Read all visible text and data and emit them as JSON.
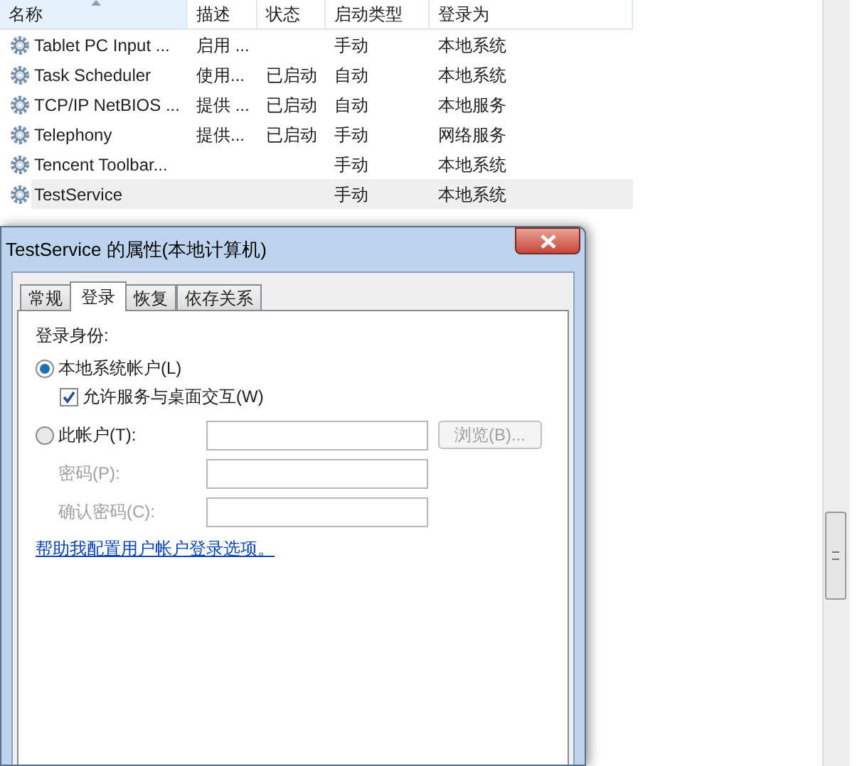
{
  "services": {
    "columns": [
      {
        "label": "名称",
        "sorted": true
      },
      {
        "label": "描述",
        "sorted": false
      },
      {
        "label": "状态",
        "sorted": false
      },
      {
        "label": "启动类型",
        "sorted": false
      },
      {
        "label": "登录为",
        "sorted": false
      }
    ],
    "rows": [
      {
        "name": "Tablet PC Input ...",
        "description": "启用 ...",
        "status": "",
        "startup": "手动",
        "logon": "本地系统",
        "selected": false
      },
      {
        "name": "Task Scheduler",
        "description": "使用...",
        "status": "已启动",
        "startup": "自动",
        "logon": "本地系统",
        "selected": false
      },
      {
        "name": "TCP/IP NetBIOS ...",
        "description": "提供 ...",
        "status": "已启动",
        "startup": "自动",
        "logon": "本地服务",
        "selected": false
      },
      {
        "name": "Telephony",
        "description": "提供...",
        "status": "已启动",
        "startup": "手动",
        "logon": "网络服务",
        "selected": false
      },
      {
        "name": "Tencent Toolbar...",
        "description": "",
        "status": "",
        "startup": "手动",
        "logon": "本地系统",
        "selected": false
      },
      {
        "name": "TestService",
        "description": "",
        "status": "",
        "startup": "手动",
        "logon": "本地系统",
        "selected": true
      }
    ]
  },
  "dialog": {
    "title": "TestService 的属性(本地计算机)",
    "tabs": [
      {
        "label": "常规",
        "selected": false
      },
      {
        "label": "登录",
        "selected": true
      },
      {
        "label": "恢复",
        "selected": false
      },
      {
        "label": "依存关系",
        "selected": false
      }
    ],
    "logon_as": "登录身份:",
    "local_system": {
      "label": "本地系统帐户(L)",
      "selected": true
    },
    "interact": {
      "label": "允许服务与桌面交互(W)",
      "checked": true
    },
    "this_account": {
      "label": "此帐户(T):",
      "selected": false
    },
    "browse_button": {
      "label": "浏览(B)...",
      "disabled": true
    },
    "password": {
      "label": "密码(P):",
      "disabled": true
    },
    "confirm_password": {
      "label": "确认密码(C):",
      "disabled": true
    },
    "help_link": "帮助我配置用户帐户登录选项。"
  }
}
